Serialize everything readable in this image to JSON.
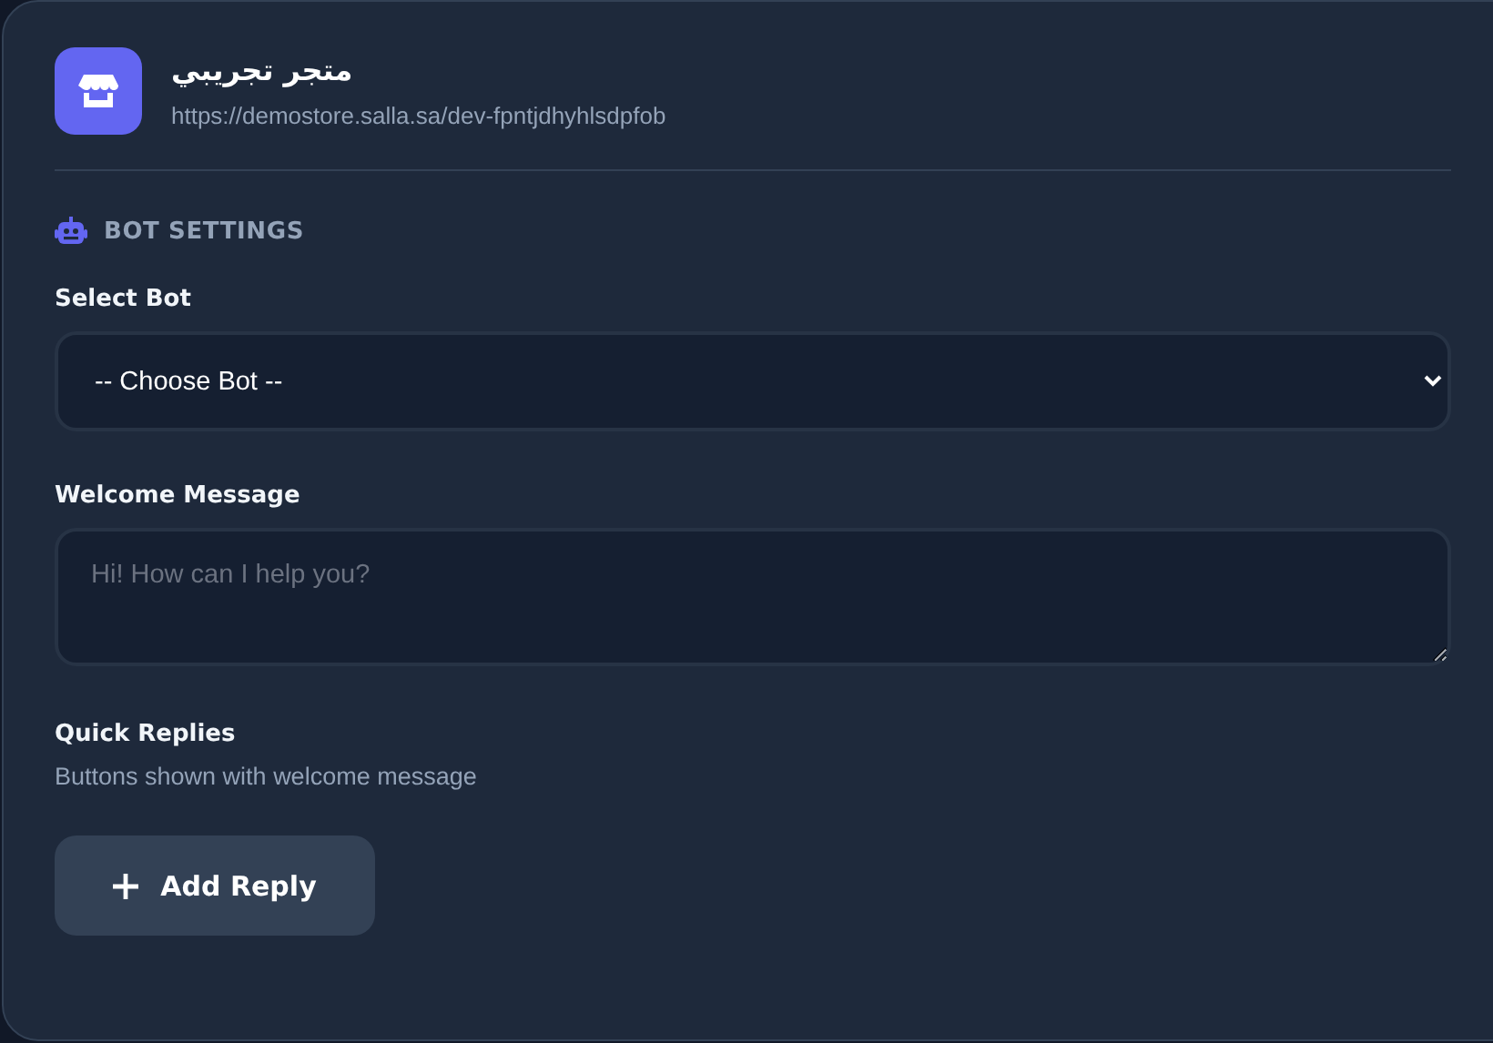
{
  "store": {
    "name": "متجر تجريبي",
    "url": "https://demostore.salla.sa/dev-fpntjdhyhlsdpfob"
  },
  "section": {
    "title": "BOT SETTINGS"
  },
  "select_bot": {
    "label": "Select Bot",
    "value": "-- Choose Bot --"
  },
  "welcome_message": {
    "label": "Welcome Message",
    "placeholder": "Hi! How can I help you?"
  },
  "quick_replies": {
    "label": "Quick Replies",
    "hint": "Buttons shown with welcome message",
    "button": "Add Reply"
  }
}
